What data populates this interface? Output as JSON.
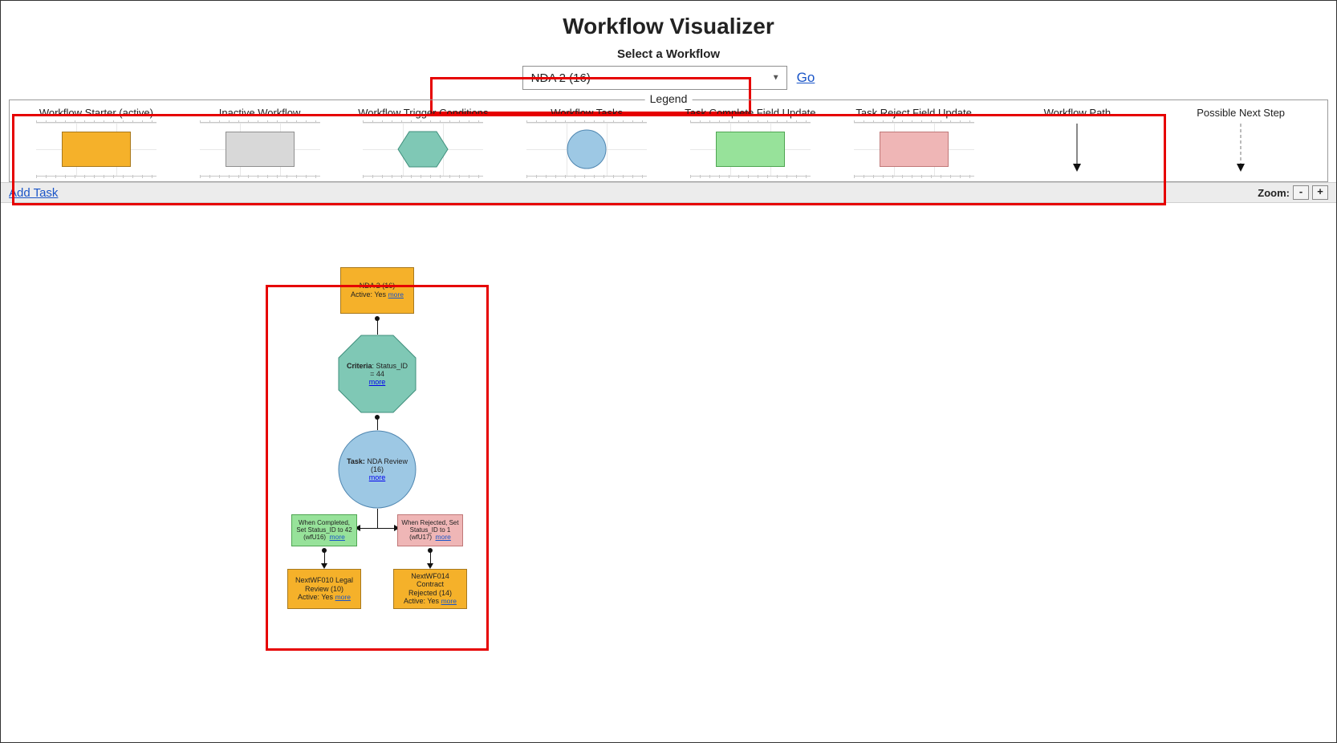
{
  "title": "Workflow Visualizer",
  "select": {
    "label": "Select a Workflow",
    "value": "NDA 2 (16)",
    "go": "Go"
  },
  "legend": {
    "title": "Legend",
    "items": {
      "starter_active": "Workflow Starter (active)",
      "inactive": "Inactive Workflow",
      "trigger": "Workflow Trigger Conditions",
      "tasks": "Workflow Tasks",
      "complete_update": "Task Complete Field Update",
      "reject_update": "Task Reject Field Update",
      "path": "Workflow Path",
      "possible_next": "Possible Next Step"
    }
  },
  "toolbar": {
    "add_task": "Add Task",
    "zoom_label": "Zoom:",
    "zoom_out": "-",
    "zoom_in": "+"
  },
  "more_label": "more",
  "diagram": {
    "starter": {
      "title": "NDA 2 (16)",
      "line2": "Active: Yes"
    },
    "criteria": {
      "prefix": "Criteria",
      "text": ": Status_ID = 44"
    },
    "task": {
      "prefix": "Task:",
      "text": "NDA Review (16)"
    },
    "complete": {
      "line1": "When Completed,",
      "line2": "Set Status_ID to 42",
      "line3": "(wfU16)"
    },
    "reject": {
      "line1": "When Rejected, Set",
      "line2": "Status_ID to 1",
      "line3": "(wfU17)"
    },
    "next_complete": {
      "line1": "NextWF010 Legal",
      "line2": "Review (10)",
      "line3": "Active: Yes"
    },
    "next_reject": {
      "line1": "NextWF014 Contract",
      "line2": "Rejected (14)",
      "line3": "Active: Yes"
    }
  }
}
